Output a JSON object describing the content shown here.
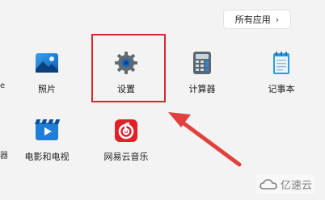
{
  "start_menu": {
    "all_apps_label": "所有应用",
    "all_apps_chevron": "›"
  },
  "edge_fragments": {
    "row1": "e",
    "row2": "器"
  },
  "pinned_apps": [
    {
      "label": "照片",
      "icon": "photos-icon"
    },
    {
      "label": "设置",
      "icon": "gear-icon"
    },
    {
      "label": "计算器",
      "icon": "calculator-icon"
    },
    {
      "label": "记事本",
      "icon": "notepad-icon"
    },
    {
      "label": "电影和电视",
      "icon": "movies-tv-icon"
    },
    {
      "label": "网易云音乐",
      "icon": "netease-music-icon"
    }
  ],
  "watermark": {
    "text": "亿速云"
  },
  "colors": {
    "highlight": "#d9272e",
    "arrow": "#e0413f"
  }
}
